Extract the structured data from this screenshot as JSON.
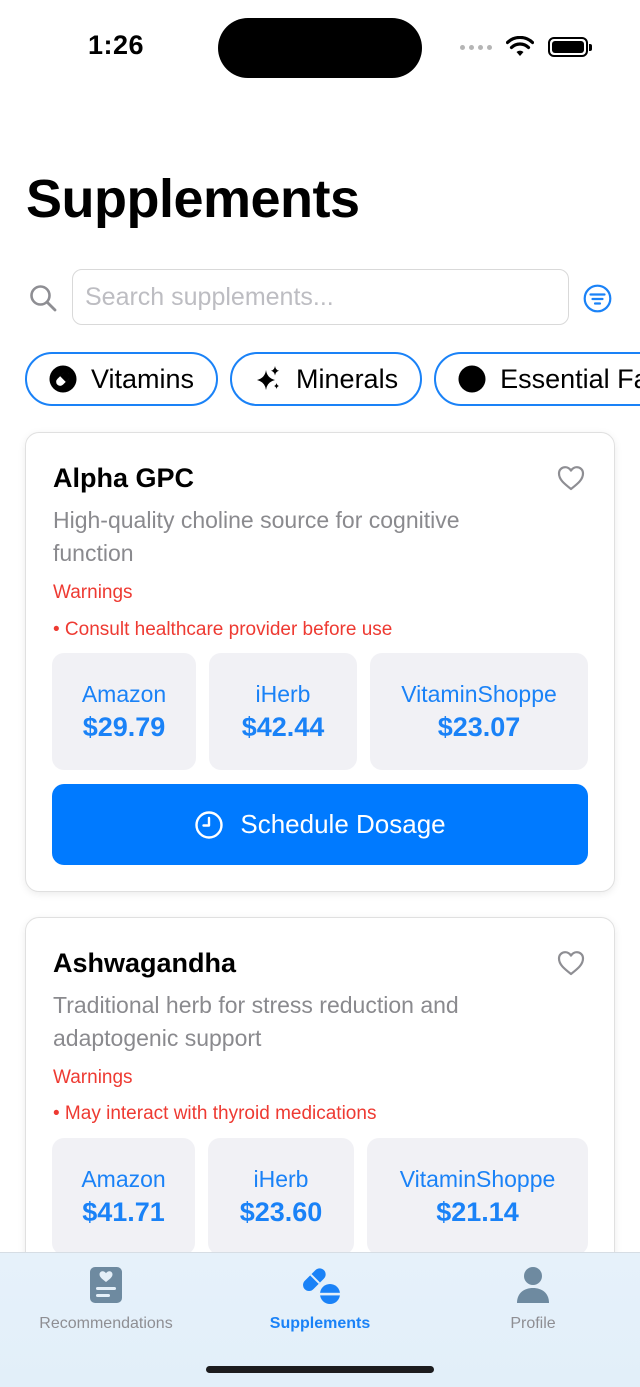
{
  "status": {
    "time": "1:26"
  },
  "page": {
    "title": "Supplements"
  },
  "search": {
    "placeholder": "Search supplements..."
  },
  "chips": [
    {
      "label": "Vitamins",
      "icon": "pill-icon"
    },
    {
      "label": "Minerals",
      "icon": "sparkles-icon"
    },
    {
      "label": "Essential Fa",
      "icon": "circle-icon"
    }
  ],
  "cards": [
    {
      "name": "Alpha GPC",
      "description": "High-quality choline source for cognitive function",
      "warnings_title": "Warnings",
      "warnings": [
        "• Consult healthcare provider before use"
      ],
      "stores": [
        {
          "name": "Amazon",
          "price": "$29.79"
        },
        {
          "name": "iHerb",
          "price": "$42.44"
        },
        {
          "name": "VitaminShoppe",
          "price": "$23.07"
        }
      ],
      "action_label": "Schedule Dosage"
    },
    {
      "name": "Ashwagandha",
      "description": "Traditional herb for stress reduction and adaptogenic support",
      "warnings_title": "Warnings",
      "warnings": [
        "• May interact with thyroid medications"
      ],
      "stores": [
        {
          "name": "Amazon",
          "price": "$41.71"
        },
        {
          "name": "iHerb",
          "price": "$23.60"
        },
        {
          "name": "VitaminShoppe",
          "price": "$21.14"
        }
      ]
    }
  ],
  "tabbar": {
    "tabs": [
      {
        "label": "Recommendations",
        "icon": "heart-clipboard-icon",
        "active": false
      },
      {
        "label": "Supplements",
        "icon": "pills-icon",
        "active": true
      },
      {
        "label": "Profile",
        "icon": "person-icon",
        "active": false
      }
    ]
  },
  "colors": {
    "accent": "#007aff",
    "accent_text": "#1a82f7",
    "warning": "#ee3a32",
    "secondary_text": "#8a8a8e",
    "store_bg": "#f1f1f5"
  }
}
